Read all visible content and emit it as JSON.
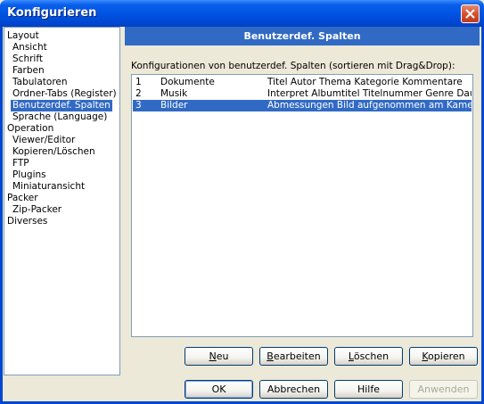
{
  "window": {
    "title": "Konfigurieren"
  },
  "tree": {
    "items": [
      {
        "label": "Layout",
        "level": 0
      },
      {
        "label": "Ansicht",
        "level": 1
      },
      {
        "label": "Schrift",
        "level": 1
      },
      {
        "label": "Farben",
        "level": 1
      },
      {
        "label": "Tabulatoren",
        "level": 1
      },
      {
        "label": "Ordner-Tabs (Register)",
        "level": 1
      },
      {
        "label": "Benutzerdef. Spalten",
        "level": 1,
        "selected": true
      },
      {
        "label": "Sprache (Language)",
        "level": 1
      },
      {
        "label": "Operation",
        "level": 0
      },
      {
        "label": "Viewer/Editor",
        "level": 1
      },
      {
        "label": "Kopieren/Löschen",
        "level": 1
      },
      {
        "label": "FTP",
        "level": 1
      },
      {
        "label": "Plugins",
        "level": 1
      },
      {
        "label": "Miniaturansicht",
        "level": 1
      },
      {
        "label": "Packer",
        "level": 0
      },
      {
        "label": "Zip-Packer",
        "level": 1
      },
      {
        "label": "Diverses",
        "level": 0
      }
    ]
  },
  "panel": {
    "header": "Benutzerdef. Spalten",
    "list_label": "Konfigurationen von benutzerdef. Spalten (sortieren mit Drag&Drop):",
    "rows": [
      {
        "num": "1",
        "name": "Dokumente",
        "columns": "Titel Autor Thema Kategorie Kommentare"
      },
      {
        "num": "2",
        "name": "Musik",
        "columns": "Interpret Albumtitel Titelnummer Genre Dauer Ii"
      },
      {
        "num": "3",
        "name": "Bilder",
        "columns": "Abmessungen Bild aufgenommen am Kameramo",
        "selected": true
      }
    ]
  },
  "buttons": {
    "neu": {
      "pre": "",
      "key": "N",
      "post": "eu"
    },
    "bearbeiten": {
      "pre": "",
      "key": "B",
      "post": "earbeiten"
    },
    "loeschen": {
      "pre": "",
      "key": "L",
      "post": "öschen"
    },
    "kopieren": {
      "pre": "",
      "key": "K",
      "post": "opieren"
    },
    "ok": "OK",
    "abbrechen": "Abbrechen",
    "hilfe": "Hilfe",
    "anwenden": "Anwenden"
  },
  "icons": {
    "close": "close-icon"
  },
  "colors": {
    "selection": "#316AC5",
    "titlebar": "#0054E3",
    "face": "#ECE9D8"
  }
}
